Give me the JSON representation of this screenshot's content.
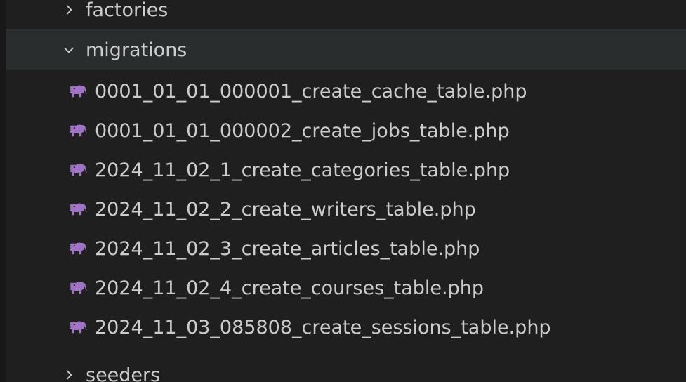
{
  "explorer": {
    "folders": {
      "factories": {
        "label": "factories",
        "expanded": false
      },
      "migrations": {
        "label": "migrations",
        "expanded": true
      },
      "seeders": {
        "label": "seeders",
        "expanded": false
      }
    },
    "migration_files": [
      {
        "name": "0001_01_01_000001_create_cache_table.php",
        "icon": "php-elephant-icon"
      },
      {
        "name": "0001_01_01_000002_create_jobs_table.php",
        "icon": "php-elephant-icon"
      },
      {
        "name": "2024_11_02_1_create_categories_table.php",
        "icon": "php-elephant-icon"
      },
      {
        "name": "2024_11_02_2_create_writers_table.php",
        "icon": "php-elephant-icon"
      },
      {
        "name": "2024_11_02_3_create_articles_table.php",
        "icon": "php-elephant-icon"
      },
      {
        "name": "2024_11_02_4_create_courses_table.php",
        "icon": "php-elephant-icon"
      },
      {
        "name": "2024_11_03_085808_create_sessions_table.php",
        "icon": "php-elephant-icon"
      }
    ],
    "colors": {
      "background": "#1f1f1f",
      "selected_row": "#2a2d2e",
      "text": "#cccccc",
      "php_icon": "#a074c4"
    }
  }
}
